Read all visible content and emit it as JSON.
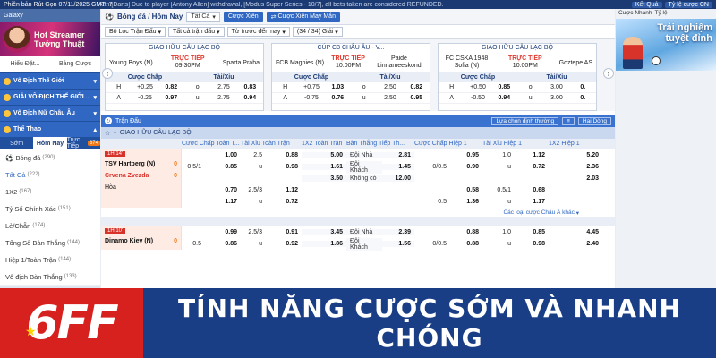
{
  "topbar": {
    "left_text": "Phiên bản Rút Gọn",
    "datetime": "07/11/2025 GMT+7",
    "news": "Attn:[Darts] Due to player [Antony Allen] withdrawal, [Modus Super Series - 10/7], all bets taken are considered REFUNDED.",
    "right": [
      "Kết Quả",
      "Tỷ lệ cược CN",
      "Cược Nhanh",
      "Tỷ lệ"
    ]
  },
  "sidebar": {
    "gallery": "Galaxy",
    "banner_line1": "Hot Streamer",
    "banner_line2": "Tướng Thuật",
    "tabs": [
      "Hiểu Đặt...",
      "Bảng Cược"
    ],
    "sections": [
      "Vô Địch Thế Giới",
      "GIẢI VÔ ĐỊCH THẾ GIỚI ...",
      "Vô Địch Nữ Châu Âu",
      "Thể Thao"
    ],
    "sub_tabs": [
      "Sớm",
      "Hôm Nay",
      "Trực Tiếp"
    ],
    "live_count": "374",
    "items": [
      {
        "label": "Bóng đá",
        "count": "(290)"
      },
      {
        "label": "Tất Cả",
        "count": "(222)"
      },
      {
        "label": "1X2",
        "count": "(167)"
      },
      {
        "label": "Tỷ Số Chính Xác",
        "count": "(151)"
      },
      {
        "label": "Lẻ/Chẵn",
        "count": "(174)"
      },
      {
        "label": "Tổng Số Bàn Thắng",
        "count": "(144)"
      },
      {
        "label": "Hiệp 1/Toàn Trận",
        "count": "(144)"
      },
      {
        "label": "Vô địch Bàn Thắng",
        "count": "(133)"
      }
    ]
  },
  "filter": {
    "sport": "Bóng đá / Hôm Nay",
    "all": "Tất Cả",
    "parlay": "Cược Xiên",
    "quick_parlay": "Cược Xiên May Mắn",
    "row2": [
      "Bộ Lọc Trận Đấu",
      "Tất cả trận đấu",
      "Từ trước đến nay",
      "(34 / 34) Giải"
    ]
  },
  "cards": [
    {
      "league": "GIAO HỮU CÂU LẠC BỘ",
      "home": "Young Boys (N)",
      "away": "Sparta Praha",
      "status": "TRỰC TIẾP",
      "time": "09:30PM",
      "h_hdp": "+0.25",
      "h_hdp_odds": "0.82",
      "h_ou": "2.75",
      "h_ou_odds": "0.83",
      "a_hdp": "-0.25",
      "a_hdp_odds": "0.97",
      "a_ou": "2.75",
      "a_ou_odds": "0.94"
    },
    {
      "league": "CÚP C3 CHÂU ÂU - V...",
      "home": "FCB Magpies (N)",
      "away": "Paide Linnameeskond",
      "status": "TRỰC TIẾP",
      "time": "10:00PM",
      "h_hdp": "+0.75",
      "h_hdp_odds": "1.03",
      "h_ou": "2.50",
      "h_ou_odds": "0.82",
      "a_hdp": "-0.75",
      "a_hdp_odds": "0.76",
      "a_ou": "2.50",
      "a_ou_odds": "0.95"
    },
    {
      "league": "GIAO HỮU CÂU LẠC BỘ",
      "home": "FC CSKA 1948 Sofia (N)",
      "away": "Goztepe AS",
      "status": "TRỰC TIẾP",
      "time": "10:00PM",
      "h_hdp": "+0.50",
      "h_hdp_odds": "0.85",
      "h_ou": "3.00",
      "h_ou_odds": "0.",
      "a_hdp": "-0.50",
      "a_hdp_odds": "0.94",
      "a_ou": "3.00",
      "a_ou_odds": "0."
    }
  ],
  "card_heads": {
    "hdp": "Cược Chấp",
    "ou": "Tài/Xỉu",
    "h": "H",
    "a": "A",
    "o": "o",
    "u": "u"
  },
  "toolbar": {
    "title": "Trận Đấu",
    "sort": "Lựa chọn định thường",
    "view": "Hai Dòng"
  },
  "league_row": "GIAO HỮU CÂU LẠC BỘ",
  "columns": [
    "Cược Chấp Toàn T...",
    "Tài Xỉu Toàn Trận",
    "1X2 Toàn Trận",
    "Bàn Thắng Tiếp Th...",
    "Cược Chấp Hiệp 1",
    "Tài Xỉu Hiệp 1",
    "1X2 Hiệp 1"
  ],
  "match1": {
    "time": "1H 14'",
    "home": "TSV Hartberg (N)",
    "home_score": "0",
    "away": "Crvena Zvezda",
    "away_score": "0",
    "draw": "Hòa",
    "rows": [
      [
        "",
        "1.00",
        "2.5",
        "0.88",
        "5.00",
        "Đội Nhà",
        "2.81",
        "",
        "0.95",
        "1.0",
        "1.12",
        "5.20"
      ],
      [
        "0.5/1",
        "0.85",
        "u",
        "0.98",
        "1.61",
        "Đội Khách",
        "1.45",
        "0/0.5",
        "0.90",
        "u",
        "0.72",
        "2.36"
      ],
      [
        "",
        "",
        "",
        "",
        "3.50",
        "Không có",
        "12.00",
        "",
        "",
        "",
        "",
        "2.03"
      ],
      [
        "",
        "0.70",
        "2.5/3",
        "1.12",
        "",
        "",
        "",
        "",
        "0.58",
        "0.5/1",
        "0.68",
        ""
      ],
      [
        "",
        "1.17",
        "u",
        "0.72",
        "",
        "",
        "",
        "0.5",
        "1.36",
        "u",
        "1.17",
        ""
      ]
    ],
    "more": "Các loại cược Châu Á khác"
  },
  "match2": {
    "time": "1H 10'",
    "home": "Dinamo Kiev (N)",
    "home_score": "0",
    "rows": [
      [
        "",
        "0.99",
        "2.5/3",
        "0.91",
        "3.45",
        "Đội Nhà",
        "2.39",
        "",
        "0.88",
        "1.0",
        "0.85",
        "4.45"
      ],
      [
        "0.5",
        "0.86",
        "u",
        "0.92",
        "1.86",
        "Đội Khách",
        "1.56",
        "0/0.5",
        "0.88",
        "u",
        "0.98",
        "2.40"
      ]
    ]
  },
  "right_banner": {
    "quick": "Cược Nhanh",
    "odds": "Tỷ lệ",
    "line1": "Trải nghiệm",
    "line2": "tuyệt đỉnh"
  },
  "promo": {
    "logo": "6FF",
    "slogan": "TÍNH NĂNG CƯỢC SỚM VÀ NHANH CHÓNG"
  },
  "colors": {
    "brand_red": "#d7211e",
    "navy": "#1a3e86",
    "accent_blue": "#2f67c2"
  }
}
